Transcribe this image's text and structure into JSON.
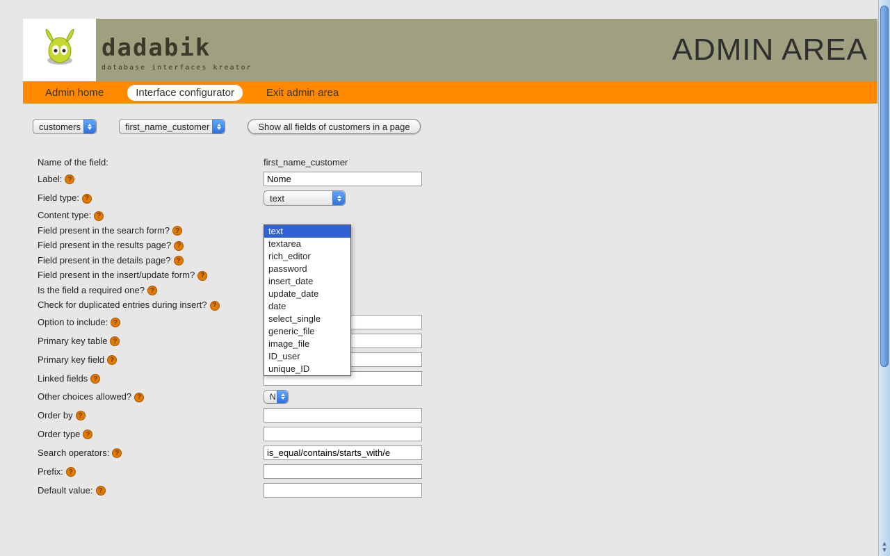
{
  "header": {
    "brand": "dadabik",
    "brand_sub": "database interfaces kreator",
    "admin_title": "ADMIN AREA"
  },
  "nav": {
    "home": "Admin home",
    "configurator": "Interface configurator",
    "exit": "Exit admin area"
  },
  "toolbar": {
    "table_select_value": "customers",
    "field_select_value": "first_name_customer",
    "show_all_button": "Show all fields of customers in a page"
  },
  "form_labels": {
    "name_of_field": "Name of the field:",
    "label": "Label:",
    "field_type": "Field type:",
    "content_type": "Content type:",
    "present_search": "Field present in the search form?",
    "present_results": "Field present in the results page?",
    "present_details": "Field present in the details page?",
    "present_insert": "Field present in the insert/update form?",
    "required": "Is the field a required one?",
    "check_dup": "Check for duplicated entries during insert?",
    "option_include": "Option to include:",
    "pk_table": "Primary key table",
    "pk_field": "Primary key field",
    "linked_fields": "Linked fields",
    "other_choices": "Other choices allowed?",
    "order_by": "Order by",
    "order_type": "Order type",
    "search_ops": "Search operators:",
    "prefix": "Prefix:",
    "default_value": "Default value:"
  },
  "form_values": {
    "name_of_field": "first_name_customer",
    "label": "Nome",
    "field_type": "text",
    "other_choices": "N",
    "search_ops": "is_equal/contains/starts_with/e",
    "option_include": "",
    "pk_table": "",
    "pk_field": "",
    "linked_fields": "",
    "order_by": "",
    "order_type": "",
    "prefix": "",
    "default_value": ""
  },
  "field_type_options": [
    "text",
    "textarea",
    "rich_editor",
    "password",
    "insert_date",
    "update_date",
    "date",
    "select_single",
    "generic_file",
    "image_file",
    "ID_user",
    "unique_ID"
  ],
  "help_icon_char": "?"
}
